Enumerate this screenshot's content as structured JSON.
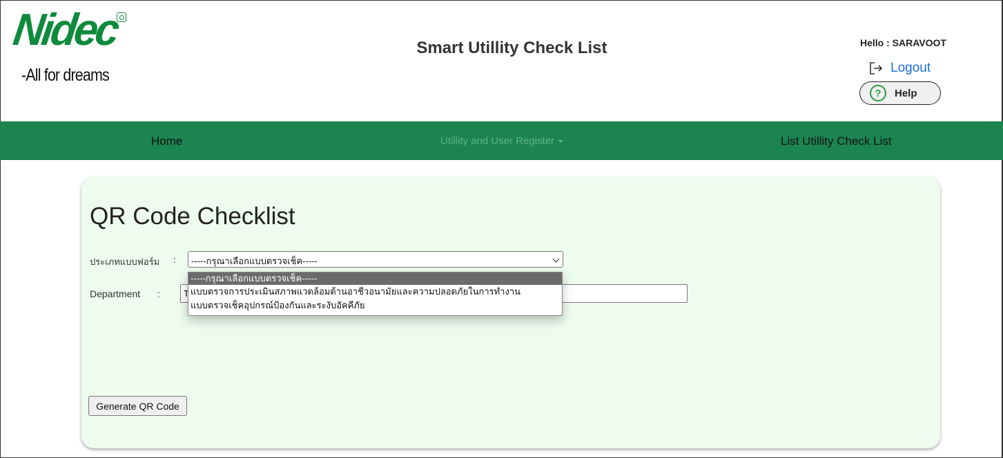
{
  "brand": {
    "logo_text": "Nidec",
    "tagline": "-All for dreams"
  },
  "header": {
    "title": "Smart Utillity Check List",
    "greeting": "Hello : SARAVOOT",
    "logout_label": "Logout",
    "help_label": "Help",
    "help_symbol": "?"
  },
  "nav": {
    "home": "Home",
    "utility_register": "Utillity and User Register",
    "list_checklist": "List Utillity Check List"
  },
  "page": {
    "title": "QR Code Checklist",
    "form_type_label": "ประเภทแบบฟอร์ม",
    "form_type_colon": ":",
    "form_type_selected": "-----กรุณาเลือกแบบตรวจเช็ค-----",
    "form_type_options": [
      "-----กรุณาเลือกแบบตรวจเช็ค-----",
      "แบบตรวจการประเมินสภาพแวดล้อมด้านอาชีวอนามัยและความปลอดภัยในการทำงาน",
      "แบบตรวจเช็คอุปกรณ์ป้องกันและระงับอัคคีภัย"
    ],
    "department_label": "Department",
    "department_colon": ":",
    "department_value": "T",
    "generate_label": "Generate QR Code"
  },
  "colors": {
    "nav_green": "#1b8451",
    "card_bg": "#eefbef",
    "brand_green": "#0f8a3c",
    "link_blue": "#1a6fd6"
  }
}
